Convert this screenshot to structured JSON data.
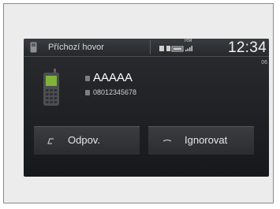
{
  "header": {
    "title": "Příchozí hovor",
    "time": "12:34",
    "rm_label": "RM",
    "call_timer": "06"
  },
  "caller": {
    "name": "AAAAA",
    "number": "08012345678"
  },
  "actions": {
    "answer_label": "Odpov.",
    "ignore_label": "Ignorovat"
  },
  "icons": [
    "phone-handset-icon",
    "bluetooth-icon",
    "battery-icon",
    "signal-icon",
    "contact-icon",
    "phone-number-icon",
    "answer-call-icon",
    "ignore-call-icon"
  ]
}
